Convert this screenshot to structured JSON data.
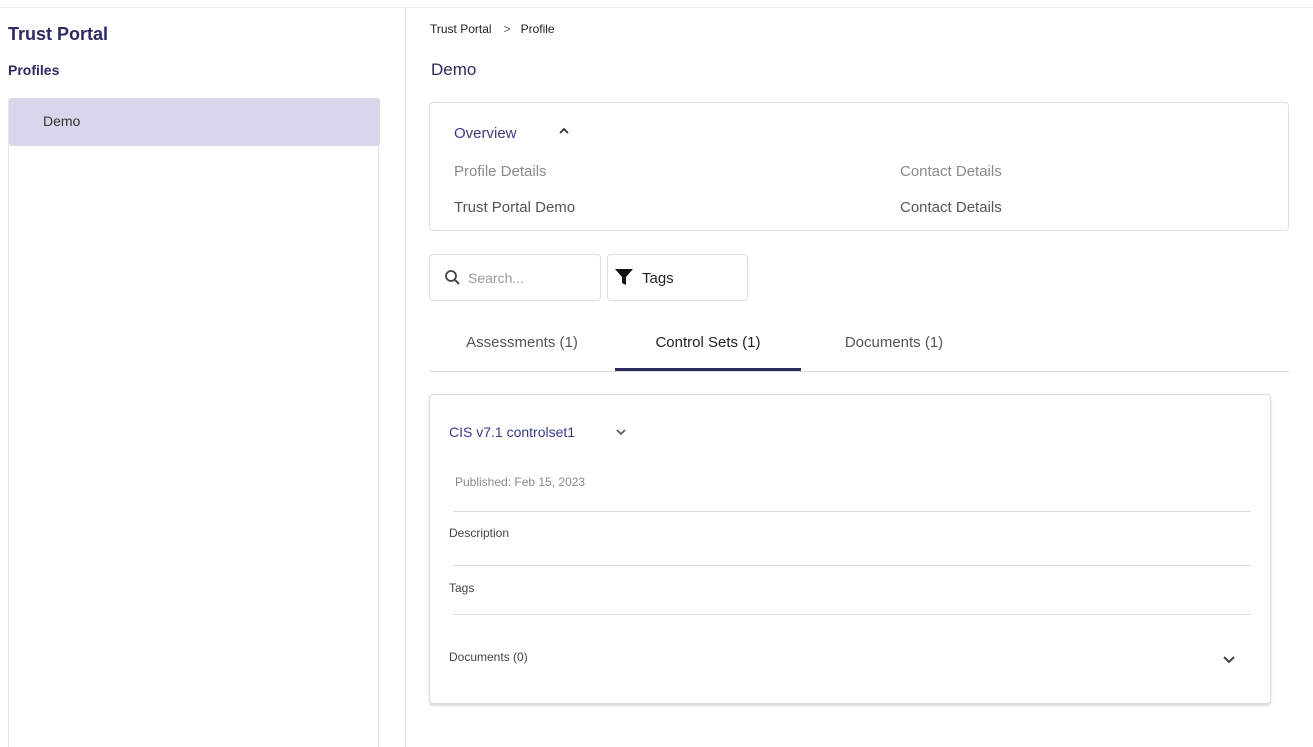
{
  "sidebar": {
    "app_title": "Trust Portal",
    "section_heading": "Profiles",
    "items": [
      {
        "label": "Demo",
        "selected": true
      }
    ]
  },
  "breadcrumb": {
    "root": "Trust Portal",
    "separator": ">",
    "current": "Profile"
  },
  "page": {
    "title": "Demo"
  },
  "overview": {
    "title": "Overview",
    "left_label": "Profile Details",
    "right_label": "Contact Details",
    "left_value": "Trust Portal Demo",
    "right_value": "Contact Details",
    "icon": "chevron-up-icon"
  },
  "filters": {
    "search_placeholder": "Search...",
    "tags_label": "Tags",
    "search_icon": "search-icon",
    "tags_icon": "filter-icon"
  },
  "tabs": [
    {
      "label": "Assessments (1)",
      "active": false
    },
    {
      "label": "Control Sets (1)",
      "active": true
    },
    {
      "label": "Documents (1)",
      "active": false
    }
  ],
  "control_set": {
    "title": "CIS v7.1 controlset1",
    "published": "Published: Feb 15, 2023",
    "description_label": "Description",
    "tags_label": "Tags",
    "documents_label": "Documents (0)"
  },
  "colors": {
    "brand": "#2c2a5e",
    "link": "#3a3a85",
    "selected_bg": "#d9d6ec"
  }
}
